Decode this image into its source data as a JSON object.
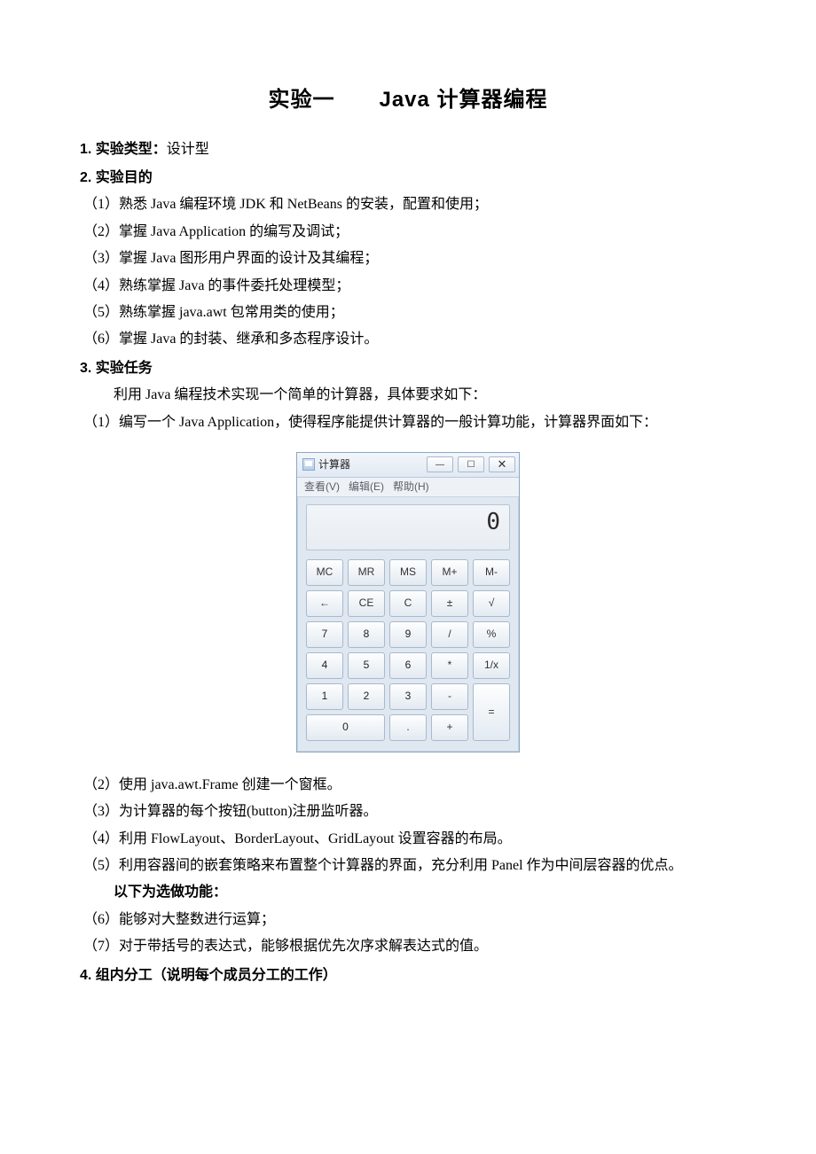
{
  "title": "实验一　　Java  计算器编程",
  "s1": {
    "head": "1.  实验类型：",
    "tail": "设计型"
  },
  "s2": {
    "head": "2.  实验目的"
  },
  "purpose": {
    "p1": "（1）熟悉 Java 编程环境 JDK 和 NetBeans 的安装，配置和使用；",
    "p2": "（2）掌握 Java Application 的编写及调试；",
    "p3": "（3）掌握 Java 图形用户界面的设计及其编程；",
    "p4": "（4）熟练掌握 Java 的事件委托处理模型；",
    "p5": "（5）熟练掌握 java.awt 包常用类的使用；",
    "p6": "（6）掌握 Java 的封装、继承和多态程序设计。"
  },
  "s3": {
    "head": "3.  实验任务"
  },
  "task_intro": "利用 Java 编程技术实现一个简单的计算器，具体要求如下：",
  "task1": "（1）编写一个 Java Application，使得程序能提供计算器的一般计算功能，计算器界面如下：",
  "calc": {
    "window_title": "计算器",
    "menu": {
      "view": "查看(V)",
      "edit": "编辑(E)",
      "help": "帮助(H)"
    },
    "display": "0",
    "btn": {
      "mc": "MC",
      "mr": "MR",
      "ms": "MS",
      "mplus": "M+",
      "mminus": "M-",
      "back": "←",
      "ce": "CE",
      "c": "C",
      "pm": "±",
      "sqrt": "√",
      "d7": "7",
      "d8": "8",
      "d9": "9",
      "div": "/",
      "pct": "%",
      "d4": "4",
      "d5": "5",
      "d6": "6",
      "mul": "*",
      "inv": "1/x",
      "d1": "1",
      "d2": "2",
      "d3": "3",
      "sub": "-",
      "eq": "=",
      "d0": "0",
      "dot": ".",
      "add": "+"
    }
  },
  "task2": "（2）使用 java.awt.Frame 创建一个窗框。",
  "task3": "（3）为计算器的每个按钮(button)注册监听器。",
  "task4": "（4）利用 FlowLayout、BorderLayout、GridLayout 设置容器的布局。",
  "task5": "（5）利用容器间的嵌套策略来布置整个计算器的界面，充分利用 Panel 作为中间层容器的优点。",
  "optional_head": "以下为选做功能：",
  "task6": "（6）能够对大整数进行运算；",
  "task7": "（7）对于带括号的表达式，能够根据优先次序求解表达式的值。",
  "s4": {
    "head": "4.  组内分工（说明每个成员分工的工作）"
  }
}
